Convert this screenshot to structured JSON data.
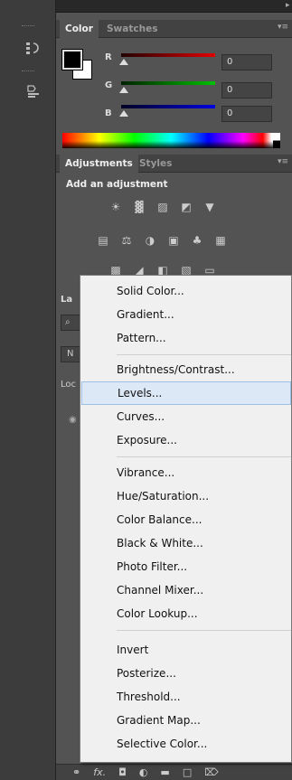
{
  "collapse_icon": "◂◂",
  "expand_icon": "▸",
  "left_strip": {
    "history_icon": "history-icon",
    "properties_icon": "properties-icon"
  },
  "color_panel": {
    "tabs": [
      "Color",
      "Swatches"
    ],
    "menu_icon": "▾≡",
    "channels": [
      {
        "label": "R",
        "value": "0",
        "color": "#e00000"
      },
      {
        "label": "G",
        "value": "0",
        "color": "#00c000"
      },
      {
        "label": "B",
        "value": "0",
        "color": "#0000e0"
      }
    ],
    "foreground": "#000000",
    "background": "#ffffff"
  },
  "adjustments_panel": {
    "tabs": [
      "Adjustments",
      "Styles"
    ],
    "menu_icon": "▾≡",
    "title": "Add an adjustment",
    "row1": [
      "☀",
      "▓",
      "▨",
      "◩",
      "▼"
    ],
    "row2": [
      "▤",
      "⚖",
      "◑",
      "▣",
      "♣",
      "▦"
    ],
    "row3": [
      "▩",
      "◢",
      "◧",
      "▧",
      "▭"
    ]
  },
  "layers_panel": {
    "tab_partial": "La",
    "search_partial": "⌕",
    "blend_partial": "N",
    "lock_partial": "Loc",
    "eye": "◉"
  },
  "bottom_bar": [
    "⚭",
    "fx.",
    "◘",
    "◐",
    "▬",
    "□",
    "⌦"
  ],
  "menu": {
    "groups": [
      [
        "Solid Color...",
        "Gradient...",
        "Pattern..."
      ],
      [
        "Brightness/Contrast...",
        "Levels...",
        "Curves...",
        "Exposure..."
      ],
      [
        "Vibrance...",
        "Hue/Saturation...",
        "Color Balance...",
        "Black & White...",
        "Photo Filter...",
        "Channel Mixer...",
        "Color Lookup..."
      ],
      [
        "Invert",
        "Posterize...",
        "Threshold...",
        "Gradient Map...",
        "Selective Color..."
      ]
    ],
    "highlighted": "Levels..."
  }
}
